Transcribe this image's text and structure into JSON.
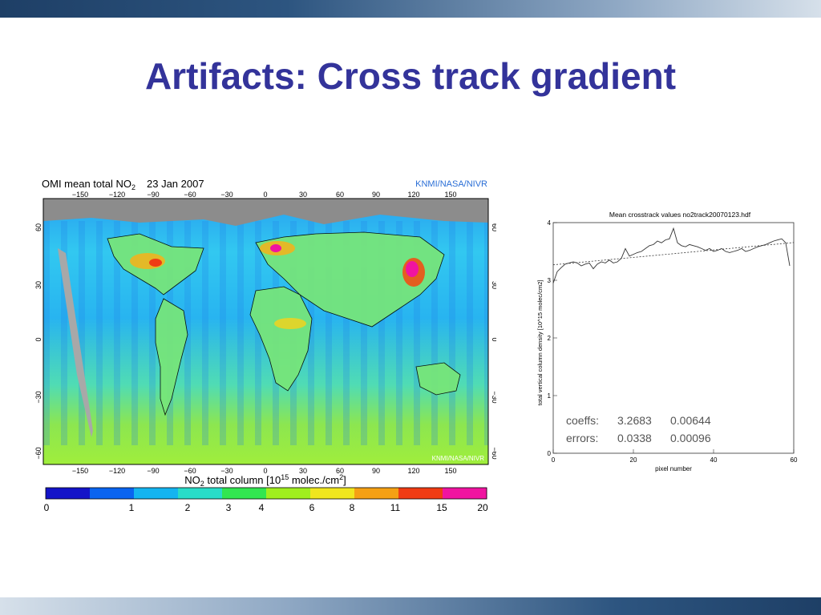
{
  "slide": {
    "title": "Artifacts: Cross track gradient"
  },
  "colors": {
    "title": "#33339a",
    "header_bar": "#1e3f66"
  },
  "map": {
    "title": "OMI mean total NO",
    "title_sub": "2",
    "date": "23 Jan 2007",
    "credit_top": "KNMI/NASA/NIVR",
    "credit_bottom": "KNMI/NASA/NIVR",
    "lon_ticks": [
      "−150",
      "−120",
      "−90",
      "−60",
      "−30",
      "0",
      "30",
      "60",
      "90",
      "120",
      "150"
    ],
    "lat_ticks": [
      "60",
      "30",
      "0",
      "−30",
      "−60"
    ],
    "colorbar_label_pre": "NO",
    "colorbar_label_sub": "2",
    "colorbar_label_mid": " total column [10",
    "colorbar_label_sup": "15",
    "colorbar_label_end": " molec./cm",
    "colorbar_label_sup2": "2",
    "colorbar_label_close": "]",
    "colorbar_ticks": [
      "0",
      "1",
      "2",
      "3",
      "4",
      "6",
      "8",
      "11",
      "15",
      "20"
    ],
    "colorbar_colors": [
      "#1414c8",
      "#0a64f0",
      "#14b4f0",
      "#28dcc8",
      "#32e650",
      "#a0ee1e",
      "#f0e61e",
      "#f5a014",
      "#f03c14",
      "#f014a0"
    ]
  },
  "chart_data": {
    "type": "line",
    "title": "Mean crosstrack values no2track20070123.hdf",
    "xlabel": "pixel number",
    "ylabel": "total vertical column density [10^15 molec/cm2]",
    "xlim": [
      0,
      60
    ],
    "ylim": [
      0,
      4
    ],
    "x_ticks": [
      "0",
      "20",
      "40",
      "60"
    ],
    "y_ticks": [
      "0",
      "1",
      "2",
      "3",
      "4"
    ],
    "series": [
      {
        "x": [
          0,
          1,
          2,
          3,
          4,
          5,
          6,
          7,
          8,
          9,
          10,
          11,
          12,
          13,
          14,
          15,
          16,
          17,
          18,
          19,
          20,
          21,
          22,
          23,
          24,
          25,
          26,
          27,
          28,
          29,
          30,
          31,
          32,
          33,
          34,
          35,
          36,
          37,
          38,
          39,
          40,
          41,
          42,
          43,
          44,
          45,
          46,
          47,
          48,
          49,
          50,
          51,
          52,
          53,
          54,
          55,
          56,
          57,
          58,
          59
        ],
        "values": [
          2.95,
          3.15,
          3.22,
          3.28,
          3.3,
          3.32,
          3.3,
          3.25,
          3.28,
          3.3,
          3.2,
          3.28,
          3.32,
          3.3,
          3.35,
          3.3,
          3.32,
          3.38,
          3.55,
          3.42,
          3.45,
          3.48,
          3.5,
          3.55,
          3.6,
          3.62,
          3.68,
          3.65,
          3.7,
          3.72,
          3.9,
          3.65,
          3.6,
          3.58,
          3.62,
          3.6,
          3.58,
          3.55,
          3.52,
          3.55,
          3.5,
          3.52,
          3.55,
          3.5,
          3.48,
          3.5,
          3.52,
          3.55,
          3.5,
          3.52,
          3.55,
          3.58,
          3.6,
          3.62,
          3.65,
          3.68,
          3.7,
          3.72,
          3.65,
          3.25
        ]
      },
      {
        "x": [
          0,
          60
        ],
        "values": [
          3.2683,
          3.6547
        ]
      }
    ],
    "annotations": {
      "coeffs_label": "coeffs:",
      "coeffs_values": [
        "3.2683",
        "0.00644"
      ],
      "errors_label": "errors:",
      "errors_values": [
        "0.0338",
        "0.00096"
      ]
    }
  }
}
